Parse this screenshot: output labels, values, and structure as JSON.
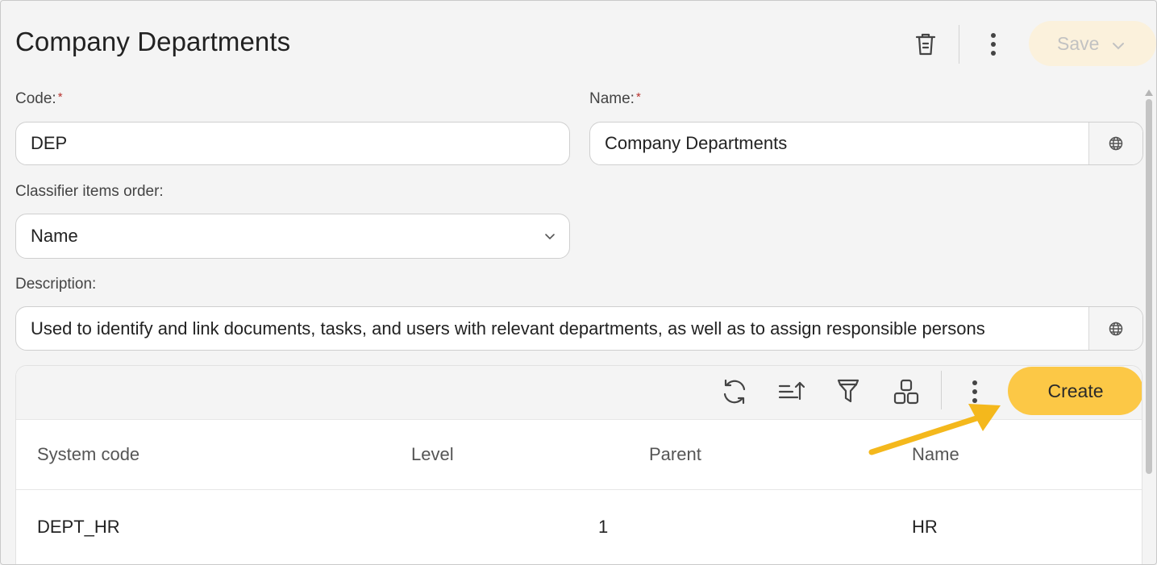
{
  "header": {
    "title": "Company Departments",
    "save_label": "Save",
    "icons": [
      "delete-icon",
      "more-vertical-icon",
      "chevron-down-icon"
    ]
  },
  "form": {
    "code": {
      "label": "Code:",
      "required_mark": "*",
      "value": "DEP"
    },
    "name": {
      "label": "Name:",
      "required_mark": "*",
      "value": "Company Departments",
      "addon_icon": "globe-icon"
    },
    "order": {
      "label": "Classifier items order:",
      "value": "Name"
    },
    "description": {
      "label": "Description:",
      "value": "Used to identify and link documents, tasks, and users with relevant departments, as well as to assign responsible persons",
      "addon_icon": "globe-icon"
    }
  },
  "grid": {
    "toolbar": {
      "icons": [
        "refresh-icon",
        "sort-icon",
        "filter-icon",
        "columns-icon",
        "more-vertical-icon"
      ],
      "create_label": "Create"
    },
    "columns": [
      "System code",
      "Level",
      "Parent",
      "Name"
    ],
    "rows": [
      {
        "system_code": "DEPT_HR",
        "level": "1",
        "parent": "",
        "name": "HR"
      }
    ]
  },
  "colors": {
    "accent": "#fcc846",
    "save_disabled_bg": "#fbf1dc",
    "arrow": "#f4b81c",
    "required": "#b8322e"
  }
}
